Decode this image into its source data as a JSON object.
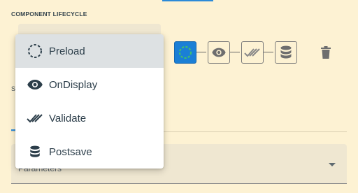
{
  "section": {
    "title": "COMPONENT LIFECYCLE"
  },
  "side_label": "S",
  "parameters": {
    "label": "Parameters"
  },
  "lifecycle": {
    "steps": [
      {
        "name": "preload",
        "icon": "dashed-circle-icon",
        "active": true
      },
      {
        "name": "ondisplay",
        "icon": "eye-icon",
        "active": false
      },
      {
        "name": "validate",
        "icon": "double-check-icon",
        "active": false
      },
      {
        "name": "postsave",
        "icon": "database-icon",
        "active": false
      }
    ],
    "active_color": "#1a7fd6"
  },
  "menu": {
    "items": [
      {
        "label": "Preload",
        "icon": "dashed-circle-icon",
        "selected": true
      },
      {
        "label": "OnDisplay",
        "icon": "eye-icon",
        "selected": false
      },
      {
        "label": "Validate",
        "icon": "double-check-icon",
        "selected": false
      },
      {
        "label": "Postsave",
        "icon": "database-icon",
        "selected": false
      }
    ]
  },
  "colors": {
    "background": "#fdf2d3",
    "accent": "#2b8ad8",
    "icon": "#2c3e4a"
  }
}
